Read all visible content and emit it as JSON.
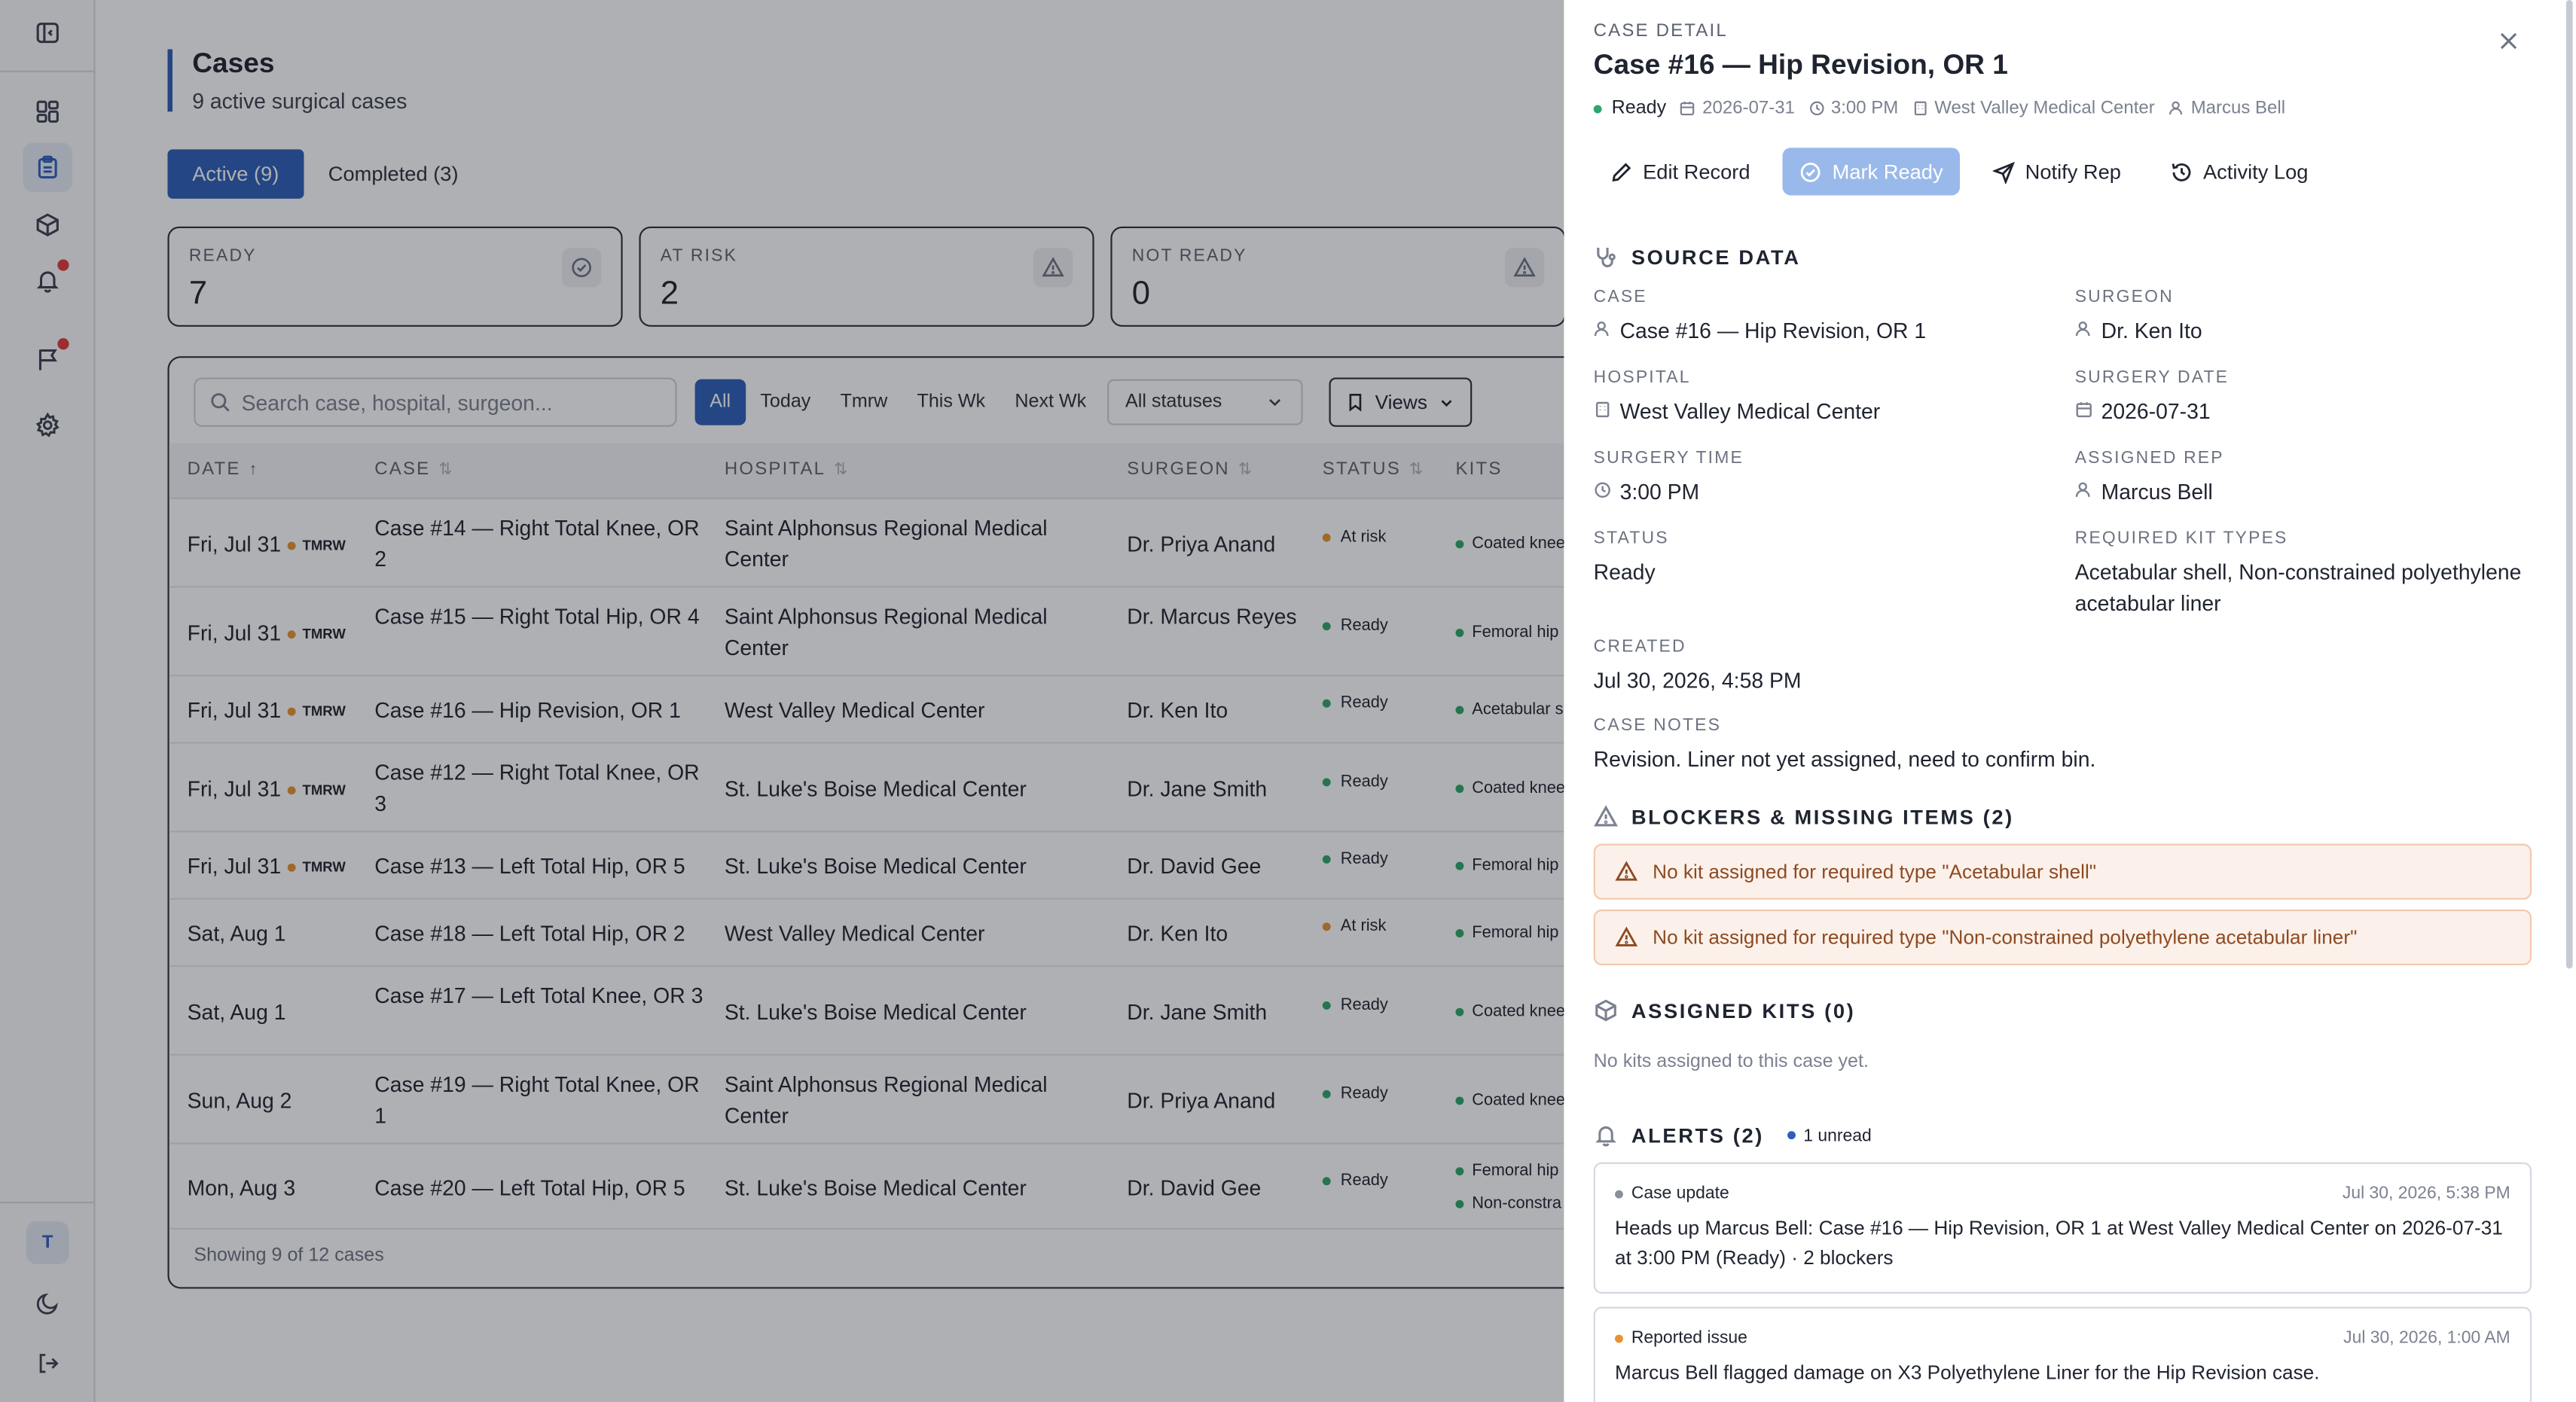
{
  "sidebar": {
    "icons": [
      "panel-toggle-icon",
      "dashboard-icon",
      "cases-icon",
      "kits-icon",
      "bell-icon",
      "flag-icon",
      "settings-icon"
    ],
    "avatar_initial": "T"
  },
  "header": {
    "title": "Cases",
    "subtitle": "9 active surgical cases"
  },
  "tabs": [
    {
      "label": "Active (9)",
      "active": true
    },
    {
      "label": "Completed (3)",
      "active": false
    }
  ],
  "stats": [
    {
      "label": "READY",
      "value": "7",
      "icon": "check-circle-icon"
    },
    {
      "label": "AT RISK",
      "value": "2",
      "icon": "warning-icon"
    },
    {
      "label": "NOT READY",
      "value": "0",
      "icon": "warning-icon"
    }
  ],
  "toolbar": {
    "search_placeholder": "Search case, hospital, surgeon...",
    "filters": [
      "All",
      "Today",
      "Tmrw",
      "This Wk",
      "Next Wk"
    ],
    "active_filter": "All",
    "status_select": "All statuses",
    "views_label": "Views"
  },
  "table": {
    "columns": [
      "DATE",
      "CASE",
      "HOSPITAL",
      "SURGEON",
      "STATUS",
      "KITS"
    ],
    "rows": [
      {
        "date": "Fri, Jul 31",
        "tmrw": "TMRW",
        "case": "Case #14 — Right Total Knee, OR 2",
        "hospital": "Saint Alphonsus Regional Medical Center",
        "surgeon": "Dr. Priya Anand",
        "status": "At risk",
        "kits": [
          "Coated knee"
        ]
      },
      {
        "date": "Fri, Jul 31",
        "tmrw": "TMRW",
        "case": "Case #15 — Right Total Hip, OR 4",
        "hospital": "Saint Alphonsus Regional Medical Center",
        "surgeon": "Dr. Marcus Reyes",
        "status": "Ready",
        "kits": [
          "Femoral hip"
        ]
      },
      {
        "date": "Fri, Jul 31",
        "tmrw": "TMRW",
        "case": "Case #16 — Hip Revision, OR 1",
        "hospital": "West Valley Medical Center",
        "surgeon": "Dr. Ken Ito",
        "status": "Ready",
        "kits": [
          "Acetabular s"
        ]
      },
      {
        "date": "Fri, Jul 31",
        "tmrw": "TMRW",
        "case": "Case #12 — Right Total Knee, OR 3",
        "hospital": "St. Luke's Boise Medical Center",
        "surgeon": "Dr. Jane Smith",
        "status": "Ready",
        "kits": [
          "Coated knee"
        ]
      },
      {
        "date": "Fri, Jul 31",
        "tmrw": "TMRW",
        "case": "Case #13 — Left Total Hip, OR 5",
        "hospital": "St. Luke's Boise Medical Center",
        "surgeon": "Dr. David Gee",
        "status": "Ready",
        "kits": [
          "Femoral hip"
        ]
      },
      {
        "date": "Sat, Aug 1",
        "tmrw": "",
        "case": "Case #18 — Left Total Hip, OR 2",
        "hospital": "West Valley Medical Center",
        "surgeon": "Dr. Ken Ito",
        "status": "At risk",
        "kits": [
          "Femoral hip"
        ]
      },
      {
        "date": "Sat, Aug 1",
        "tmrw": "",
        "case": "Case #17 — Left Total Knee, OR 3",
        "hospital": "St. Luke's Boise Medical Center",
        "surgeon": "Dr. Jane Smith",
        "status": "Ready",
        "kits": [
          "Coated knee"
        ]
      },
      {
        "date": "Sun, Aug 2",
        "tmrw": "",
        "case": "Case #19 — Right Total Knee, OR 1",
        "hospital": "Saint Alphonsus Regional Medical Center",
        "surgeon": "Dr. Priya Anand",
        "status": "Ready",
        "kits": [
          "Coated knee"
        ]
      },
      {
        "date": "Mon, Aug 3",
        "tmrw": "",
        "case": "Case #20 — Left Total Hip, OR 5",
        "hospital": "St. Luke's Boise Medical Center",
        "surgeon": "Dr. David Gee",
        "status": "Ready",
        "kits": [
          "Femoral hip",
          "Non-constra"
        ]
      }
    ],
    "footer": "Showing 9 of 12 cases"
  },
  "colors": {
    "accent": "#2d5fb8",
    "ready": "#2ea66a",
    "at_risk": "#e8922f"
  },
  "detail": {
    "eyebrow": "CASE DETAIL",
    "title": "Case #16 — Hip Revision, OR 1",
    "meta": {
      "status": "Ready",
      "date": "2026-07-31",
      "time": "3:00 PM",
      "hospital": "West Valley Medical Center",
      "rep": "Marcus Bell"
    },
    "actions": [
      "Edit Record",
      "Mark Ready",
      "Notify Rep",
      "Activity Log"
    ],
    "source_heading": "SOURCE DATA",
    "fields": {
      "case_label": "CASE",
      "case": "Case #16 — Hip Revision, OR 1",
      "surgeon_label": "SURGEON",
      "surgeon": "Dr. Ken Ito",
      "hospital_label": "HOSPITAL",
      "hospital": "West Valley Medical Center",
      "surgery_date_label": "SURGERY DATE",
      "surgery_date": "2026-07-31",
      "surgery_time_label": "SURGERY TIME",
      "surgery_time": "3:00 PM",
      "assigned_rep_label": "ASSIGNED REP",
      "assigned_rep": "Marcus Bell",
      "status_label": "STATUS",
      "status": "Ready",
      "kit_types_label": "REQUIRED KIT TYPES",
      "kit_types": "Acetabular shell, Non-constrained polyethylene acetabular liner",
      "created_label": "CREATED",
      "created": "Jul 30, 2026, 4:58 PM",
      "notes_label": "CASE NOTES",
      "notes": "Revision. Liner not yet assigned, need to confirm bin."
    },
    "blockers_heading": "BLOCKERS & MISSING ITEMS (2)",
    "blockers": [
      "No kit assigned for required type \"Acetabular shell\"",
      "No kit assigned for required type \"Non-constrained polyethylene acetabular liner\""
    ],
    "kits_heading": "ASSIGNED KITS (0)",
    "no_kits": "No kits assigned to this case yet.",
    "alerts_heading": "ALERTS (2)",
    "alerts_unread": "1 unread",
    "alerts": [
      {
        "kind": "Case update",
        "time": "Jul 30, 2026, 5:38 PM",
        "message": "Heads up Marcus Bell: Case #16 — Hip Revision, OR 1 at West Valley Medical Center on 2026-07-31 at 3:00 PM (Ready) · 2 blockers"
      },
      {
        "kind": "Reported issue",
        "time": "Jul 30, 2026, 1:00 AM",
        "message": "Marcus Bell flagged damage on X3 Polyethylene Liner for the Hip Revision case."
      }
    ]
  }
}
